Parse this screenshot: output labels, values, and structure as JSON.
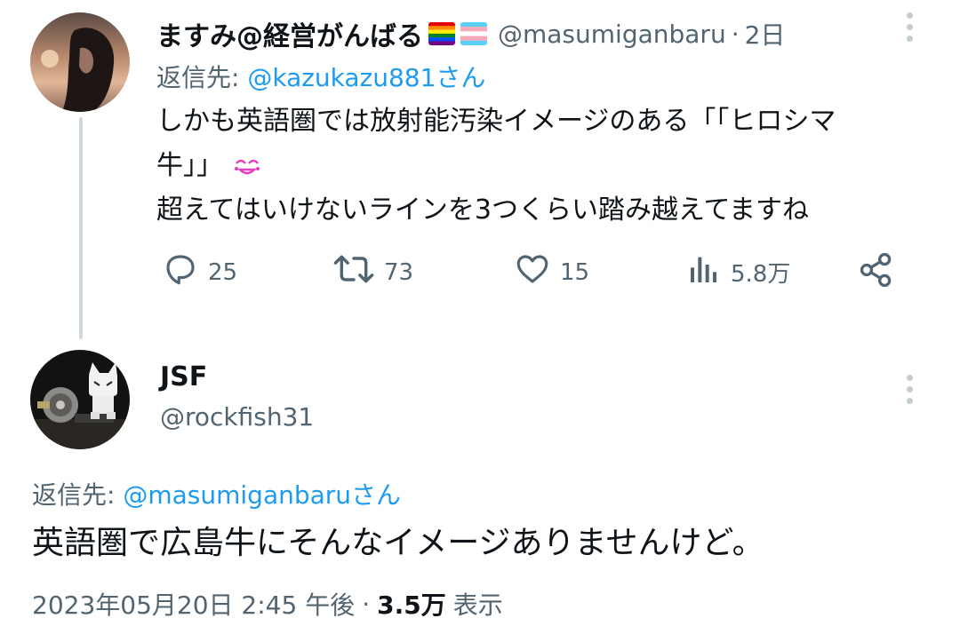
{
  "reply_tweet": {
    "display_name": "ますみ@経営がんばる",
    "handle": "@masumiganbaru",
    "separator": "·",
    "time": "2日",
    "reply_to_prefix": "返信先:",
    "reply_to_handle": "@kazukazu881さん",
    "body_lines": [
      "しかも英語圏では放射能汚染イメージのある「「ヒロシマ",
      "牛」」",
      "超えてはいけないラインを3つくらい踏み越えてますね"
    ],
    "emoji_icon": "smiling-face-with-tears-icon",
    "stats": {
      "replies": "25",
      "retweets": "73",
      "likes": "15",
      "views": "5.8万"
    },
    "flags": [
      "rainbow-flag-icon",
      "transgender-flag-icon"
    ]
  },
  "main_tweet": {
    "display_name": "JSF",
    "handle": "@rockfish31",
    "reply_to_prefix": "返信先:",
    "reply_to_handle": "@masumiganbaruさん",
    "body": "英語圏で広島牛にそんなイメージありませんけど。",
    "timestamp": "2023年05月20日 2:45 午後",
    "separator": "·",
    "views_count": "3.5万",
    "views_label": "表示"
  },
  "colors": {
    "accent": "#1d9bf0",
    "text": "#0f1419",
    "secondary": "#536471",
    "thread_line": "#cfd9de"
  }
}
